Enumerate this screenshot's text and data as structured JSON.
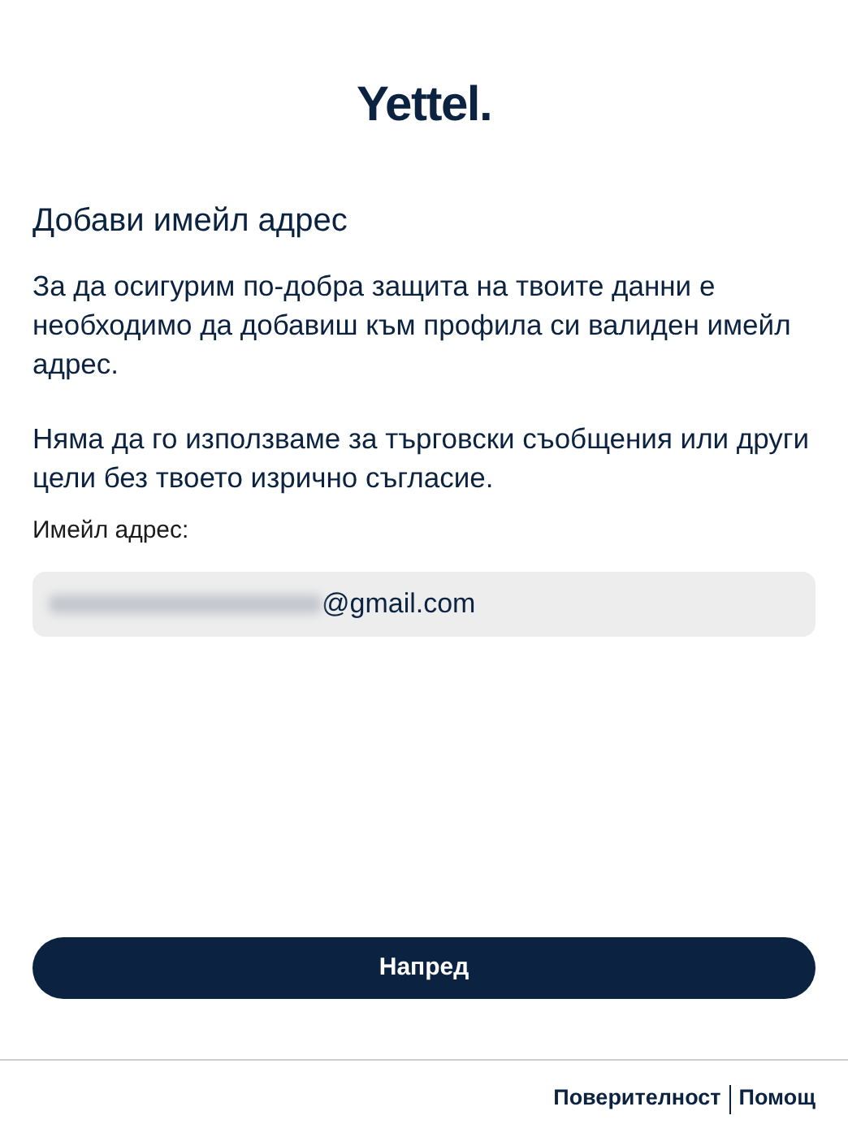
{
  "logo": "Yettel.",
  "title": "Добави имейл адрес",
  "paragraphs": [
    "За да осигурим по-добра защита на твоите данни е необходимо да добавиш към профила си валиден имейл адрес.",
    "Няма да го използваме за търговски съобщения или други цели без твоето изрично съгласие."
  ],
  "email_field": {
    "label": "Имейл адрес:",
    "value": "@gmail.com",
    "redacted": true
  },
  "submit_button": "Напред",
  "footer_links": [
    {
      "label": "Поверителност"
    },
    {
      "label": "Помощ"
    }
  ]
}
